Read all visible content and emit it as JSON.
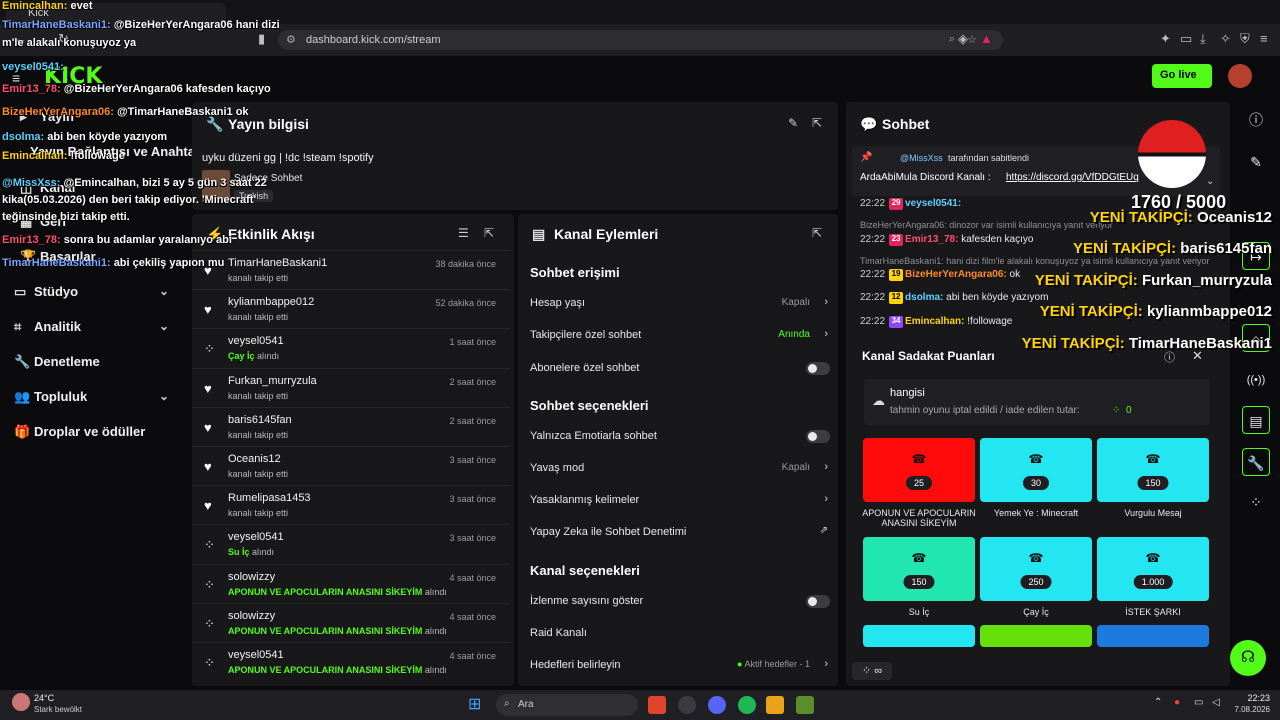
{
  "browser": {
    "tab_title": "Kick",
    "url": "dashboard.kick.com/stream"
  },
  "header": {
    "logo": "KICK",
    "go_live": "Go live"
  },
  "sidebar": {
    "items": [
      {
        "label": "Yayın",
        "icon": "broadcast-icon"
      },
      {
        "label": "Yayın Bağlantısı ve Anahtarı",
        "icon": "key-icon"
      },
      {
        "label": "Kanal",
        "icon": "channel-icon"
      },
      {
        "label": "Geri",
        "icon": "back-icon"
      },
      {
        "label": "Başarılar",
        "icon": "trophy-icon"
      },
      {
        "label": "Stüdyo",
        "icon": "studio-icon"
      },
      {
        "label": "Analitik",
        "icon": "chart-icon"
      },
      {
        "label": "Denetleme",
        "icon": "wrench-icon"
      },
      {
        "label": "Topluluk",
        "icon": "community-icon"
      },
      {
        "label": "Droplar ve ödüller",
        "icon": "gift-icon"
      }
    ]
  },
  "stream_info": {
    "title": "Yayın bilgisi",
    "stream_title": "uyku düzeni gg | !dc !steam !spotify",
    "category": "Sadece Sohbet",
    "language": "Turkish"
  },
  "activity": {
    "title": "Etkinlik Akışı",
    "rows": [
      {
        "name": "TimarHaneBaskani1",
        "sub": "kanalı takip etti",
        "time": "38 dakika önce",
        "icon": "heart-icon"
      },
      {
        "name": "kylianmbappe012",
        "sub": "kanalı takip etti",
        "time": "52 dakika önce",
        "icon": "heart-icon"
      },
      {
        "name": "veysel0541",
        "sub": "Çay İç",
        "sub2": "alındı",
        "time": "1 saat önce",
        "icon": "points-icon"
      },
      {
        "name": "Furkan_murryzula",
        "sub": "kanalı takip etti",
        "time": "2 saat önce",
        "icon": "heart-icon"
      },
      {
        "name": "baris6145fan",
        "sub": "kanalı takip etti",
        "time": "2 saat önce",
        "icon": "heart-icon"
      },
      {
        "name": "Oceanis12",
        "sub": "kanalı takip etti",
        "time": "3 saat önce",
        "icon": "heart-icon"
      },
      {
        "name": "Rumelipasa1453",
        "sub": "kanalı takip etti",
        "time": "3 saat önce",
        "icon": "heart-icon"
      },
      {
        "name": "veysel0541",
        "sub": "Su İç",
        "sub2": "alındı",
        "time": "3 saat önce",
        "icon": "points-icon"
      },
      {
        "name": "solowizzy",
        "sub": "APONUN VE APOCULARIN ANASINI SİKEYİM",
        "sub2": "alındı",
        "time": "4 saat önce",
        "icon": "points-icon"
      },
      {
        "name": "solowizzy",
        "sub": "APONUN VE APOCULARIN ANASINI SİKEYİM",
        "sub2": "alındı",
        "time": "4 saat önce",
        "icon": "points-icon"
      },
      {
        "name": "veysel0541",
        "sub": "APONUN VE APOCULARIN ANASINI SİKEYİM",
        "sub2": "alındı",
        "time": "4 saat önce",
        "icon": "points-icon"
      }
    ]
  },
  "channel_actions": {
    "title": "Kanal Eylemleri",
    "sec1": "Sohbet erişimi",
    "hesap_yasi": "Hesap yaşı",
    "hesap_yasi_val": "Kapalı",
    "takipci_sohbet": "Takipçilere özel sohbet",
    "takipci_sohbet_val": "Anında",
    "abone_sohbet": "Abonelere özel sohbet",
    "sec2": "Sohbet seçenekleri",
    "emote": "Yalnızca Emotiarla sohbet",
    "yavas": "Yavaş mod",
    "yavas_val": "Kapalı",
    "yasak": "Yasaklanmış kelimeler",
    "ai": "Yapay Zeka ile Sohbet Denetimi",
    "sec3": "Kanal seçenekleri",
    "izlenme": "İzlenme sayısını göster",
    "raid": "Raid Kanalı",
    "hedef": "Hedefleri belirleyin",
    "hedef_val": "Aktif hedefler - 1"
  },
  "chat": {
    "title": "Sohbet",
    "pinned_by": "@MissXss",
    "pinned_suffix": "tarafından sabitlendi",
    "pinned_text": "ArdaAbiMula Discord Kanalı :",
    "pinned_link": "https://discord.gg/VfDDGtEUq",
    "msgs": [
      {
        "time": "22:22",
        "badge": "29",
        "user": "veysel0541:",
        "text": "",
        "color": "#5bd1ff"
      },
      {
        "time": "22:22",
        "badge": "23",
        "user": "Emir13_78:",
        "text": "kafesden kaçıyo",
        "color": "#ff4f70"
      },
      {
        "time": "22:22",
        "badge": "19",
        "user": "BizeHerYerAngara06:",
        "text": "ok",
        "color": "#ff8a1f"
      },
      {
        "time": "22:22",
        "badge": "12",
        "user": "dsolma:",
        "text": "abi ben köyde yazıyom",
        "color": "#5bd1ff"
      },
      {
        "time": "22:22",
        "badge": "34",
        "user": "Emincalhan:",
        "text": "!followage",
        "color": "#ffd400"
      }
    ],
    "sys1": "BizeHerYerAngara06: dinozor var isimli kullanıcıya yanıt veriyor",
    "sys2": "TimarHaneBaskani1: hani dizi film'le alakalı konuşuyoz ya isimli kullanıcıya yanıt veriyor"
  },
  "loyalty": {
    "title": "Kanal Sadakat Puanları",
    "pred_user": "hangisi",
    "pred_text": "tahmin oyunu iptal edildi / iade edilen tutar:",
    "pred_val": "0",
    "rewards": [
      {
        "cost": "25",
        "label": "APONUN VE APOCULARIN ANASINI SİKEYİM",
        "color": "#ff0b0b"
      },
      {
        "cost": "30",
        "label": "Yemek Ye : Minecraft",
        "color": "#24e6f0"
      },
      {
        "cost": "150",
        "label": "Vurgulu Mesaj",
        "color": "#24e6f0"
      },
      {
        "cost": "150",
        "label": "Su İç",
        "color": "#22e6b0"
      },
      {
        "cost": "250",
        "label": "Çay İç",
        "color": "#24e6f0"
      },
      {
        "cost": "1.000",
        "label": "İSTEK ŞARKI",
        "color": "#24e6f0"
      }
    ],
    "bottom": "∞"
  },
  "overlay": {
    "counter": "1760 / 5000",
    "follow_key": "YENİ TAKİPÇİ:",
    "followers": [
      "Oceanis12",
      "baris6145fan",
      "Furkan_murryzula",
      "kylianmbappe012",
      "TimarHaneBaskani1"
    ],
    "chat": [
      {
        "user": "Emincalhan:",
        "text": "evet",
        "color": "#ffd400"
      },
      {
        "user": "TimarHaneBaskani1:",
        "text": "@BizeHerYerAngara06 hani dizi",
        "color": "#7aa7ff"
      },
      {
        "user": "",
        "text": "m'le alakalı konuşuyoz ya",
        "color": "#fff"
      },
      {
        "user": "veysel0541:",
        "text": "",
        "color": "#5bd1ff"
      },
      {
        "user": "Emir13_78:",
        "text": "@BizeHerYerAngara06 kafesden kaçıyo",
        "color": "#ff4f70"
      },
      {
        "user": "BizeHerYerAngara06:",
        "text": "@TimarHaneBaskani1 ok",
        "color": "#ff8a1f"
      },
      {
        "user": "dsolma:",
        "text": "abi ben köyde yazıyom",
        "color": "#5bd1ff"
      },
      {
        "user": "Emincalhan:",
        "text": "!followage",
        "color": "#ffd400"
      },
      {
        "user": "@MissXss:",
        "text": "@Emincalhan, bizi 5 ay 5 gün 3 saat 22",
        "color": "#5bd1ff"
      },
      {
        "user": "",
        "text": "kika(05.03.2026) den beri takip ediyor. 'Minecraft'",
        "color": "#fff"
      },
      {
        "user": "",
        "text": "teğinsinde bizi takip etti.",
        "color": "#fff"
      },
      {
        "user": "Emir13_78:",
        "text": "sonra bu adamlar yaralanıyo abi",
        "color": "#ff4f70"
      },
      {
        "user": "TimarHaneBaskani1:",
        "text": "abi çekiliş yapıon mu",
        "color": "#7aa7ff"
      }
    ]
  },
  "taskbar": {
    "weather_temp": "24°C",
    "weather_text": "Stark bewölkt",
    "search": "Ara",
    "time": "22:23",
    "date": "7.08.2026"
  },
  "colors": {
    "accent": "#53fc18",
    "panel": "#18181b",
    "bg": "#0b0b0d"
  }
}
